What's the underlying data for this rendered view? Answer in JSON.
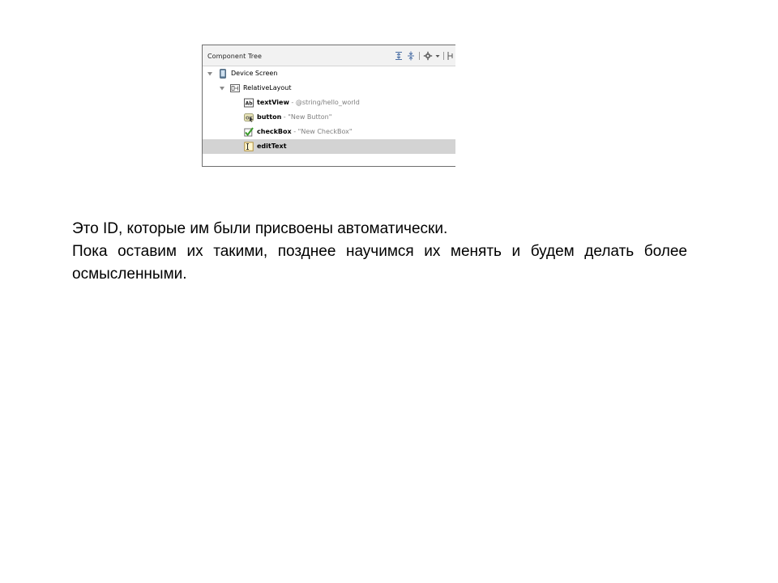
{
  "component_tree": {
    "title": "Component Tree",
    "toolbar": {
      "icons": [
        "expand-all-icon",
        "collapse-all-icon",
        "gear-icon",
        "dropdown-arrow-icon",
        "pin-icon"
      ]
    },
    "nodes": [
      {
        "id": "",
        "name": "Device Screen",
        "detail": "",
        "icon": "device-icon",
        "expander": "expanded",
        "selected": false
      },
      {
        "id": "",
        "name": "RelativeLayout",
        "detail": "",
        "icon": "relative-layout-icon",
        "expander": "expanded",
        "selected": false
      },
      {
        "id": "textView",
        "sep": " - ",
        "detail": "@string/hello_world",
        "icon": "textview-icon",
        "selected": false
      },
      {
        "id": "button",
        "sep": " - ",
        "detail": "\"New Button\"",
        "icon": "button-icon",
        "selected": false
      },
      {
        "id": "checkBox",
        "sep": " - ",
        "detail": "\"New CheckBox\"",
        "icon": "checkbox-icon",
        "selected": false
      },
      {
        "id": "editText",
        "sep": "",
        "detail": "",
        "icon": "edittext-icon",
        "selected": true
      }
    ]
  },
  "slide": {
    "paragraph_1": "Это ID, которые им были присвоены автоматически.",
    "paragraph_2": "Пока оставим их такими, позднее научимся их менять и будем делать более осмысленными."
  },
  "colors": {
    "selection": "#d3d3d3",
    "header_bg": "#f2f2f2",
    "detail_text": "#808080",
    "checkbox_green": "#3a9a2a"
  }
}
